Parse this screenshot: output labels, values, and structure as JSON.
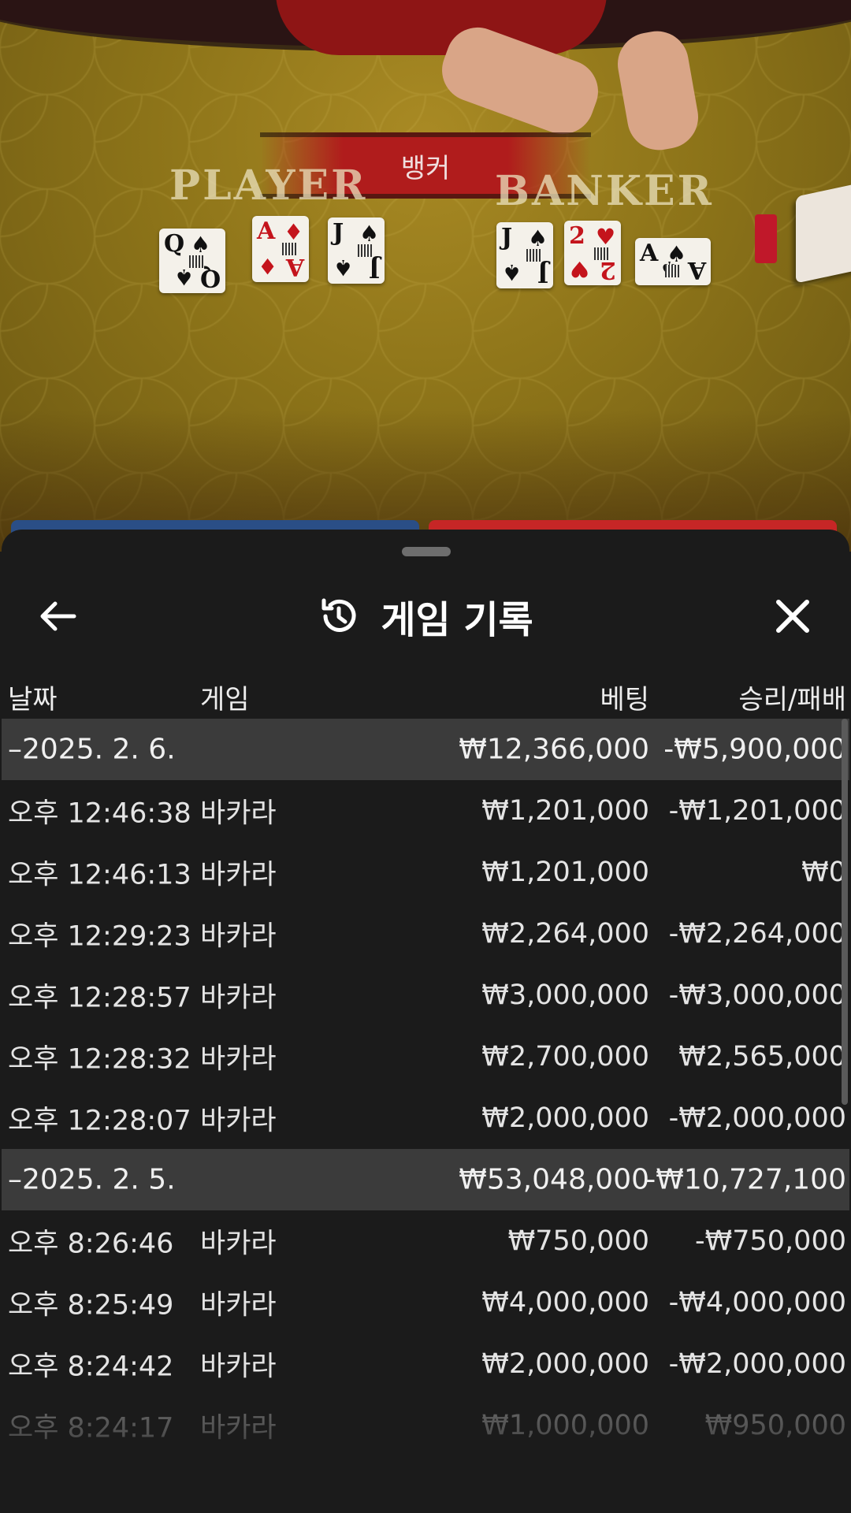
{
  "table": {
    "winner_banner": "뱅커",
    "player_label": "PLAYER",
    "banker_label": "BANKER",
    "player_cards": [
      {
        "rank": "Q",
        "suit": "♠",
        "color": "black"
      },
      {
        "rank": "A",
        "suit": "♦",
        "color": "red"
      },
      {
        "rank": "J",
        "suit": "♠",
        "color": "black"
      }
    ],
    "banker_cards": [
      {
        "rank": "J",
        "suit": "♠",
        "color": "black"
      },
      {
        "rank": "2",
        "suit": "♥",
        "color": "red"
      },
      {
        "rank": "A",
        "suit": "♠",
        "color": "black"
      }
    ]
  },
  "sheet": {
    "title": "게임 기록",
    "back_icon": "arrow-left-icon",
    "history_icon": "history-clock-icon",
    "close_icon": "close-icon",
    "columns": {
      "date": "날짜",
      "game": "게임",
      "bet": "베팅",
      "result": "승리/패배"
    },
    "groups": [
      {
        "date": "–2025. 2. 6.",
        "bet_total": "₩12,366,000",
        "result_total": "-₩5,900,000",
        "rows": [
          {
            "time": "오후 12:46:38",
            "game": "바카라",
            "bet": "₩1,201,000",
            "result": "-₩1,201,000"
          },
          {
            "time": "오후 12:46:13",
            "game": "바카라",
            "bet": "₩1,201,000",
            "result": "₩0"
          },
          {
            "time": "오후 12:29:23",
            "game": "바카라",
            "bet": "₩2,264,000",
            "result": "-₩2,264,000"
          },
          {
            "time": "오후 12:28:57",
            "game": "바카라",
            "bet": "₩3,000,000",
            "result": "-₩3,000,000"
          },
          {
            "time": "오후 12:28:32",
            "game": "바카라",
            "bet": "₩2,700,000",
            "result": "₩2,565,000"
          },
          {
            "time": "오후 12:28:07",
            "game": "바카라",
            "bet": "₩2,000,000",
            "result": "-₩2,000,000"
          }
        ]
      },
      {
        "date": "–2025. 2. 5.",
        "bet_total": "₩53,048,000",
        "result_total": "-₩10,727,100",
        "rows": [
          {
            "time": "오후 8:26:46",
            "game": "바카라",
            "bet": "₩750,000",
            "result": "-₩750,000"
          },
          {
            "time": "오후 8:25:49",
            "game": "바카라",
            "bet": "₩4,000,000",
            "result": "-₩4,000,000"
          },
          {
            "time": "오후 8:24:42",
            "game": "바카라",
            "bet": "₩2,000,000",
            "result": "-₩2,000,000"
          },
          {
            "time": "오후 8:24:17",
            "game": "바카라",
            "bet": "₩1,000,000",
            "result": "₩950,000"
          }
        ]
      }
    ]
  }
}
